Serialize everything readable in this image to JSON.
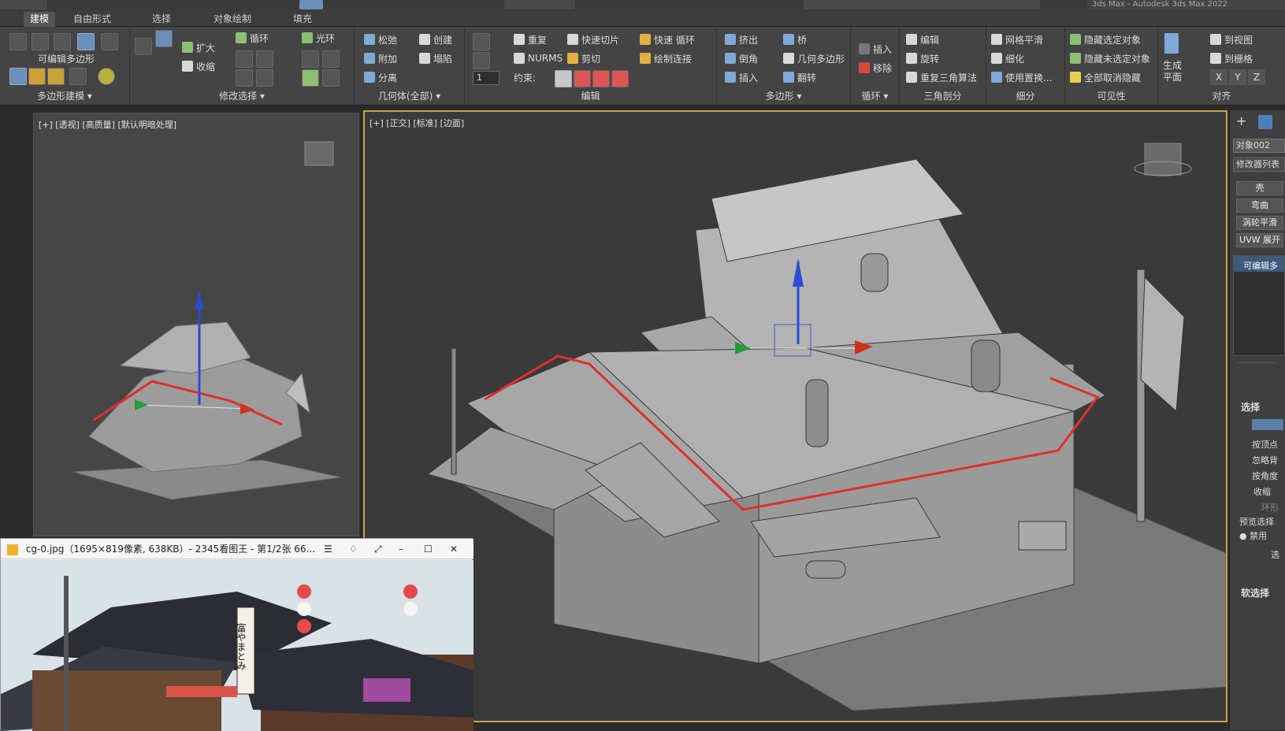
{
  "window": {
    "title": "3ds Max - Autodesk 3ds Max 2022"
  },
  "tabs": [
    {
      "label": "建模",
      "active": true
    },
    {
      "label": "自由形式",
      "active": false
    },
    {
      "label": "选择",
      "active": false
    },
    {
      "label": "对象绘制",
      "active": false
    },
    {
      "label": "填充",
      "active": false
    }
  ],
  "ribbon": {
    "groups": {
      "poly_model": {
        "label": "多边形建模 ▾",
        "sub": "可编辑多边形"
      },
      "modify_sel": {
        "label": "修改选择 ▾",
        "expand": "扩大",
        "shrink": "收缩",
        "loop": "循环",
        "ring": "光环"
      },
      "geometry": {
        "label": "几何体(全部) ▾",
        "relax": "松弛",
        "attach": "附加",
        "detach": "分离",
        "create": "创建",
        "collapse": "塌陷"
      },
      "edit": {
        "label": "编辑",
        "repeat": "重复",
        "nurms": "NURMS",
        "quickslice": "快速切片",
        "cut": "剪切",
        "swiftloop": "快速 循环",
        "paintconnect": "绘制连接",
        "constrain": "约束:",
        "spinner": "1"
      },
      "polygons": {
        "label": "多边形 ▾",
        "extrude": "挤出",
        "bevel": "倒角",
        "inset": "插入",
        "bridge": "桥",
        "geopoly": "几何多边形",
        "flip": "翻转"
      },
      "loops": {
        "label": "循环 ▾",
        "insert": "插入",
        "remove": "移除"
      },
      "tris": {
        "label": "三角剖分",
        "edit": "编辑",
        "turn": "旋转",
        "retri": "重复三角算法"
      },
      "subdiv": {
        "label": "细分",
        "meshsmooth": "网格平滑",
        "tessellate": "细化",
        "usedisp": "使用置换..."
      },
      "visibility": {
        "label": "可见性",
        "hidesel": "隐藏选定对象",
        "hideunsel": "隐藏未选定对象",
        "unhideall": "全部取消隐藏"
      },
      "align": {
        "label": "对齐",
        "genplane": "生成平面",
        "toview": "到视图",
        "togrid": "到栅格",
        "x": "X",
        "y": "Y",
        "z": "Z"
      }
    }
  },
  "viewports": {
    "left_label": "[+] [透视] [高质量] [默认明暗处理]",
    "main_label": "[+] [正交] [标准] [边面]"
  },
  "command_panel": {
    "object_name": "对象002",
    "modifier_list": "修改器列表",
    "buttons": [
      "壳",
      "弯曲",
      "涡轮平滑",
      "UVW 展开"
    ],
    "stack_item": "可编辑多",
    "selection_title": "选择",
    "options": [
      "按顶点",
      "忽略背",
      "按角度",
      "收缩"
    ],
    "ring": "环形",
    "preview_sel": "预览选择",
    "disabled": "禁用",
    "sel_short": "选",
    "soft_sel": "软选择"
  },
  "image_viewer": {
    "title": "cg-0.jpg（1695×819像素, 638KB）- 2345看图王 - 第1/2张 66...",
    "sign_text": "富やまとみ"
  },
  "colors": {
    "accent_selection": "#e0302a",
    "viewport_border": "#c8a24a"
  }
}
